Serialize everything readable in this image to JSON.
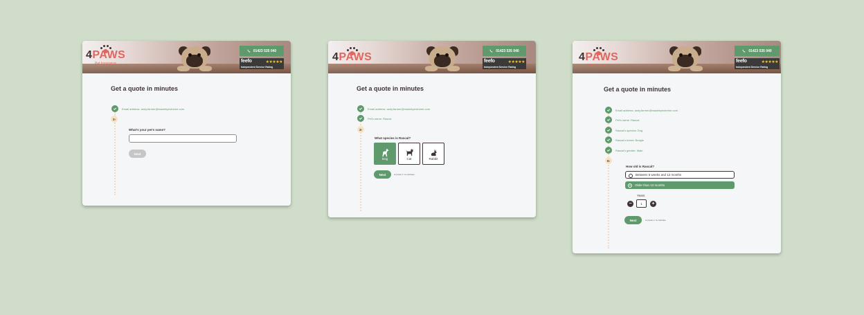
{
  "brand": {
    "logo": "4PAWS",
    "tagline": "Pet Insurance",
    "phone": "01423 535 040",
    "feefo_name": "feefo",
    "feefo_stars": "★★★★★",
    "feefo_rating": "Independent Service Rating",
    "colors": {
      "primary": "#5f9a6c",
      "accent": "#e0675f",
      "dark": "#3e3436",
      "background": "#d0ddca"
    }
  },
  "screen1": {
    "title": "Get a quote in minutes",
    "completed": [
      "Email address: andy.farmer@madebyextreme.com"
    ],
    "current_step": "2",
    "question": "What's your pet's name?",
    "input_value": "",
    "next_label": "Next"
  },
  "screen2": {
    "title": "Get a quote in minutes",
    "completed": [
      "Email address: andy.farmer@madebyextreme.com",
      "Pet's name: Rascal"
    ],
    "current_step": "3",
    "question": "What species is Rascal?",
    "options": [
      "Dog",
      "Cat",
      "Rabbit"
    ],
    "selected": "Dog",
    "next_label": "Next",
    "hint": "or press ↵ to continue"
  },
  "screen3": {
    "title": "Get a quote in minutes",
    "completed": [
      "Email address: andy.farmer@madebyextreme.com",
      "Pet's name: Rascal",
      "Rascal's species: Dog",
      "Rascal's breed: Beagle",
      "Rascal's gender: Male"
    ],
    "current_step": "6",
    "question": "How old is Rascal?",
    "options": [
      "Between 6 weeks and 12 months",
      "Older than 12 months"
    ],
    "selected": "Older than 12 months",
    "years_label": "Years",
    "years_value": "1",
    "next_label": "Next",
    "hint": "or press ↵ to continue"
  }
}
